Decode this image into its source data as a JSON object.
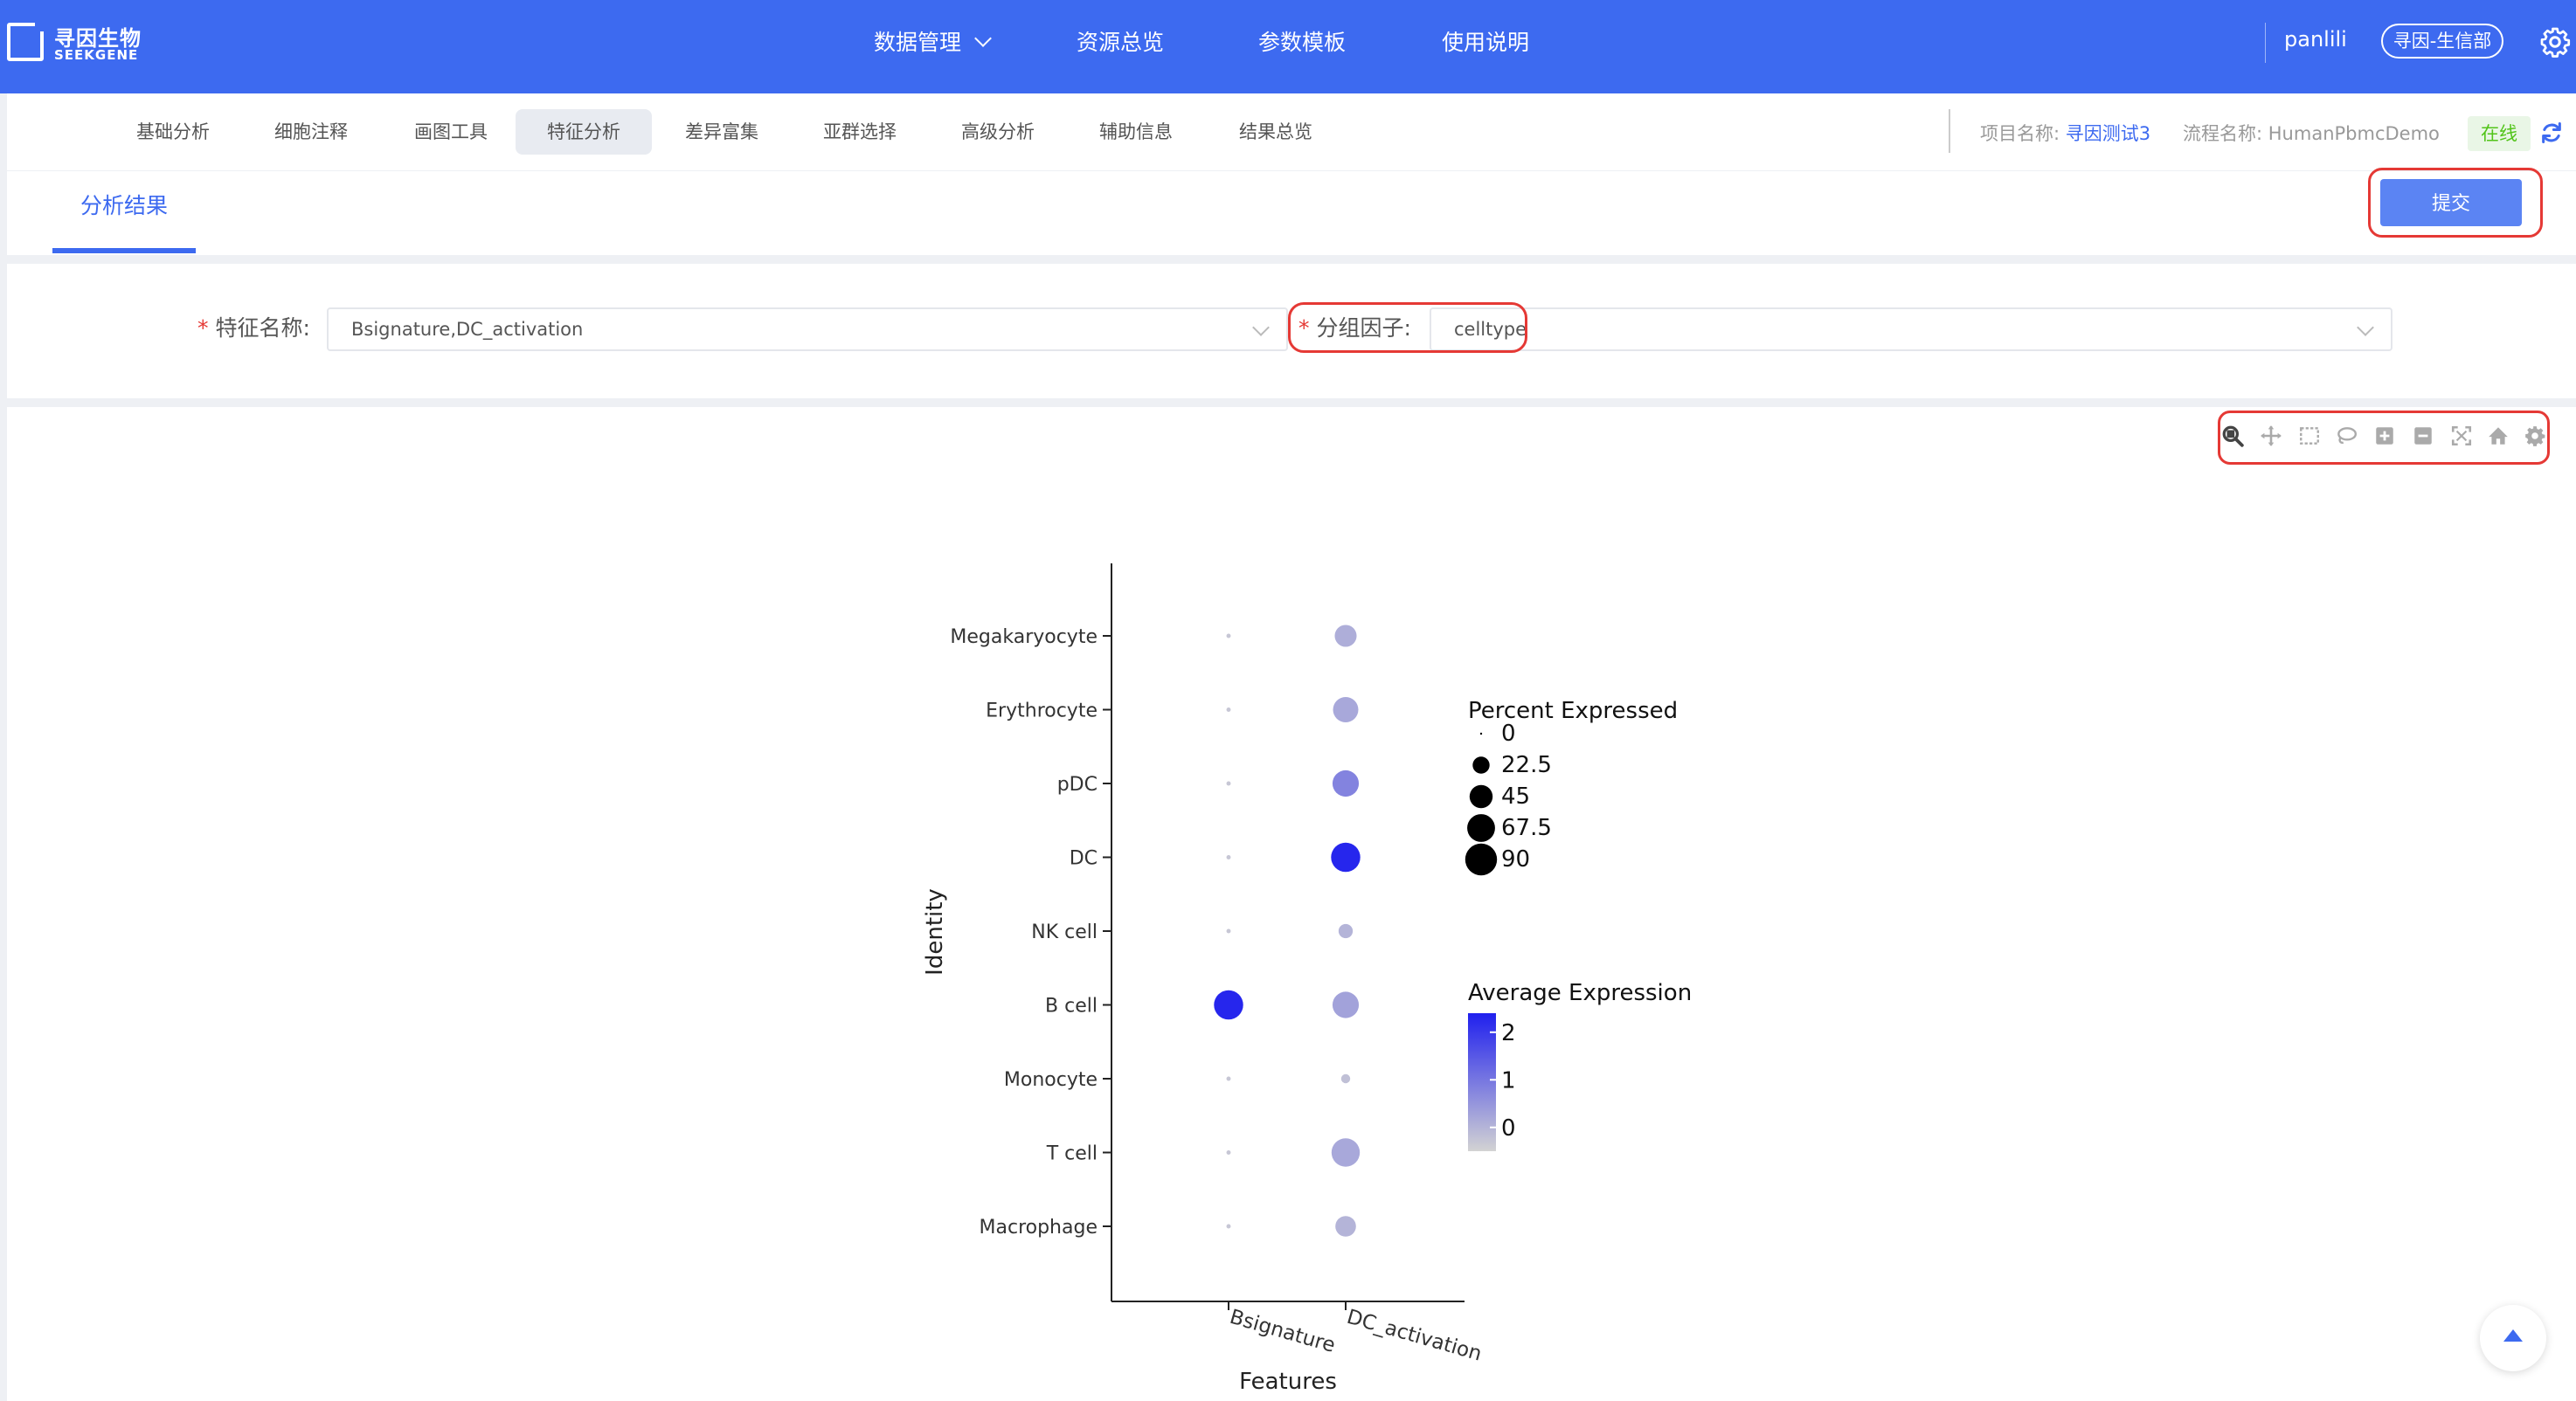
{
  "brand": {
    "name_cn": "寻因生物",
    "name_en": "SEEKGENE"
  },
  "topnav": {
    "items": [
      "数据管理",
      "资源总览",
      "参数模板",
      "使用说明"
    ],
    "user": "panlili",
    "org": "寻因-生信部"
  },
  "subnav": {
    "items": [
      "基础分析",
      "细胞注释",
      "画图工具",
      "特征分析",
      "差异富集",
      "亚群选择",
      "高级分析",
      "辅助信息",
      "结果总览"
    ],
    "active": "特征分析",
    "project_label": "项目名称:",
    "project_value": "寻因测试3",
    "pipeline_label": "流程名称:",
    "pipeline_value": "HumanPbmcDemo",
    "status": "在线"
  },
  "tabs": {
    "active": "分析结果",
    "submit_label": "提交"
  },
  "form": {
    "feature_label": "特征名称:",
    "feature_value": "Bsignature,DC_activation",
    "group_label": "分组因子:",
    "group_value": "celltype"
  },
  "toolbar": [
    "zoom-icon",
    "pan-icon",
    "box-select-icon",
    "lasso-select-icon",
    "zoom-in-icon",
    "zoom-out-icon",
    "autoscale-icon",
    "reset-axes-icon",
    "settings-icon"
  ],
  "colors": {
    "primary": "#3d6af0",
    "highlight": "#e53935",
    "online": "#52c41a"
  },
  "chart_data": {
    "type": "scatter",
    "xlabel": "Features",
    "ylabel": "Identity",
    "x": [
      "Bsignature",
      "DC_activation"
    ],
    "y": [
      "Megakaryocyte",
      "Erythrocyte",
      "pDC",
      "DC",
      "NK cell",
      "B cell",
      "Monocyte",
      "T cell",
      "Macrophage"
    ],
    "points": [
      {
        "feature": "Bsignature",
        "identity": "Megakaryocyte",
        "pct": 0.5,
        "avg": -0.3
      },
      {
        "feature": "Bsignature",
        "identity": "Erythrocyte",
        "pct": 0.5,
        "avg": -0.3
      },
      {
        "feature": "Bsignature",
        "identity": "pDC",
        "pct": 0.5,
        "avg": -0.3
      },
      {
        "feature": "Bsignature",
        "identity": "DC",
        "pct": 0.5,
        "avg": -0.3
      },
      {
        "feature": "Bsignature",
        "identity": "NK cell",
        "pct": 0.5,
        "avg": -0.3
      },
      {
        "feature": "Bsignature",
        "identity": "B cell",
        "pct": 75,
        "avg": 2.3
      },
      {
        "feature": "Bsignature",
        "identity": "Monocyte",
        "pct": 0.5,
        "avg": -0.3
      },
      {
        "feature": "Bsignature",
        "identity": "T cell",
        "pct": 0.5,
        "avg": -0.3
      },
      {
        "feature": "Bsignature",
        "identity": "Macrophage",
        "pct": 0.5,
        "avg": -0.3
      },
      {
        "feature": "DC_activation",
        "identity": "Megakaryocyte",
        "pct": 40,
        "avg": 0.1
      },
      {
        "feature": "DC_activation",
        "identity": "Erythrocyte",
        "pct": 55,
        "avg": 0.2
      },
      {
        "feature": "DC_activation",
        "identity": "pDC",
        "pct": 60,
        "avg": 0.8
      },
      {
        "feature": "DC_activation",
        "identity": "DC",
        "pct": 75,
        "avg": 2.3
      },
      {
        "feature": "DC_activation",
        "identity": "NK cell",
        "pct": 15,
        "avg": 0.0
      },
      {
        "feature": "DC_activation",
        "identity": "B cell",
        "pct": 60,
        "avg": 0.3
      },
      {
        "feature": "DC_activation",
        "identity": "Monocyte",
        "pct": 5,
        "avg": -0.2
      },
      {
        "feature": "DC_activation",
        "identity": "T cell",
        "pct": 70,
        "avg": 0.2
      },
      {
        "feature": "DC_activation",
        "identity": "Macrophage",
        "pct": 35,
        "avg": 0.0
      }
    ],
    "size_legend": {
      "title": "Percent Expressed",
      "values": [
        0,
        22.5,
        45,
        67.5,
        90
      ],
      "labels": [
        "0",
        "22.5",
        "45",
        "67.5",
        "90"
      ]
    },
    "color_legend": {
      "title": "Average Expression",
      "ticks": [
        2,
        1,
        0
      ],
      "tick_labels": [
        "2",
        "1",
        "0"
      ],
      "range": [
        -0.5,
        2.4
      ],
      "low_color": "#d3d3d3",
      "high_color": "#2020ee"
    }
  }
}
